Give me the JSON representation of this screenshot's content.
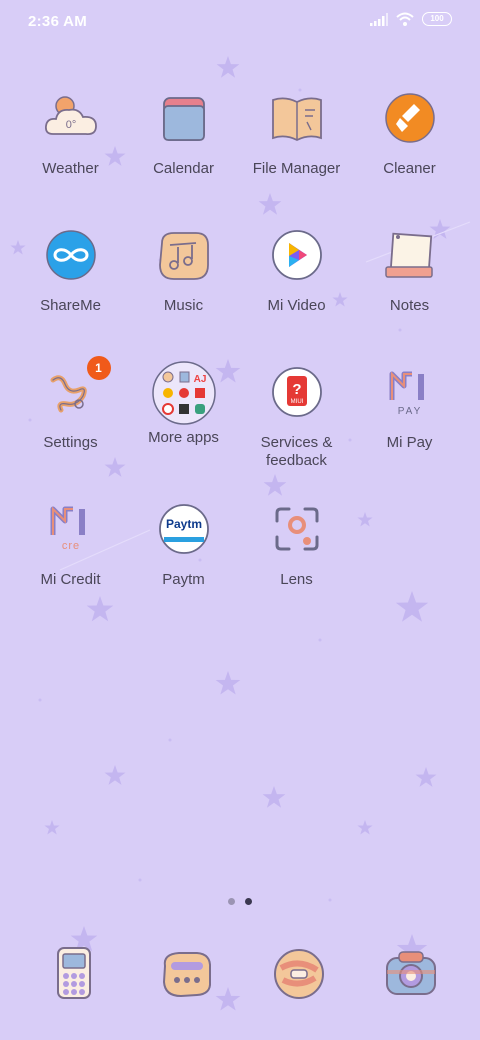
{
  "status_bar": {
    "time": "2:36 AM",
    "battery": "100"
  },
  "apps": [
    {
      "label": "Weather",
      "icon": "weather-icon",
      "temp": "0°"
    },
    {
      "label": "Calendar",
      "icon": "calendar-icon"
    },
    {
      "label": "File Manager",
      "icon": "file-manager-icon"
    },
    {
      "label": "Cleaner",
      "icon": "cleaner-icon"
    },
    {
      "label": "ShareMe",
      "icon": "shareme-icon"
    },
    {
      "label": "Music",
      "icon": "music-icon"
    },
    {
      "label": "Mi Video",
      "icon": "mi-video-icon"
    },
    {
      "label": "Notes",
      "icon": "notes-icon"
    },
    {
      "label": "Settings",
      "icon": "settings-icon",
      "badge": "1"
    },
    {
      "label": "More apps",
      "icon": "folder-icon"
    },
    {
      "label": "Services & feedback",
      "icon": "services-feedback-icon",
      "icon_text": "MIUI"
    },
    {
      "label": "Mi Pay",
      "icon": "mi-pay-icon",
      "icon_text": "PAY"
    },
    {
      "label": "Mi Credit",
      "icon": "mi-credit-icon",
      "icon_text": "cre"
    },
    {
      "label": "Paytm",
      "icon": "paytm-icon",
      "icon_text": "Paytm"
    },
    {
      "label": "Lens",
      "icon": "lens-icon"
    }
  ],
  "page_indicator": {
    "pages": 2,
    "active": 2
  },
  "dock": [
    {
      "icon": "phone-icon"
    },
    {
      "icon": "messages-icon"
    },
    {
      "icon": "browser-icon"
    },
    {
      "icon": "camera-icon"
    }
  ],
  "colors": {
    "background": "#d8cdf7",
    "label": "#4a4658",
    "badge": "#f05a1a"
  }
}
